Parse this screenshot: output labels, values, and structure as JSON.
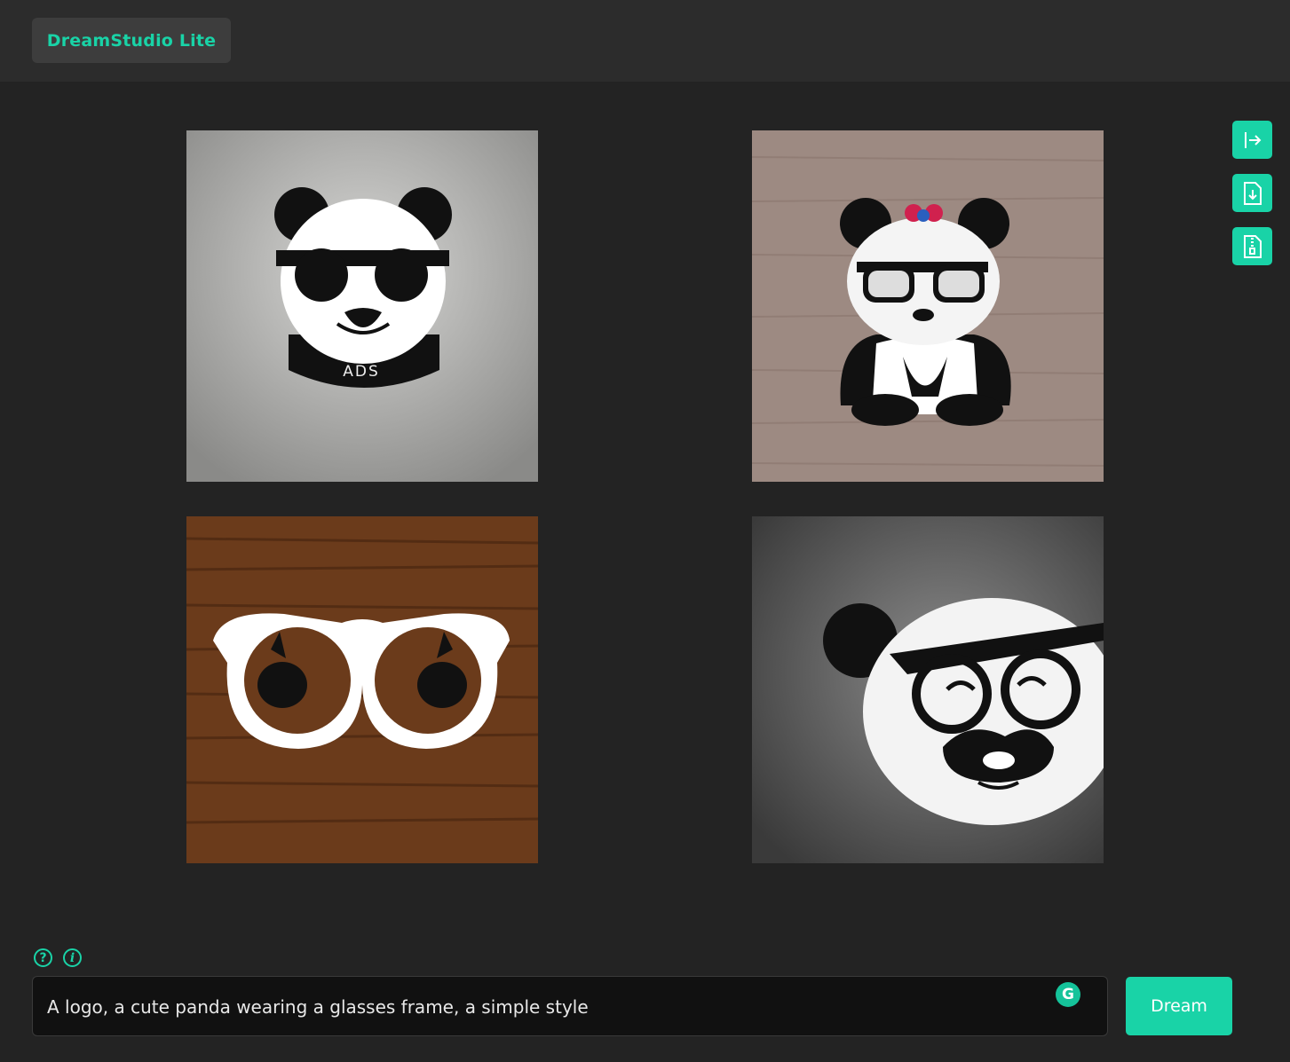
{
  "app": {
    "brand": "DreamStudio Lite",
    "accent": "#19d3a7"
  },
  "gallery": {
    "images": [
      {
        "name": "panda-sunglasses-logo",
        "caption_text": "ADS"
      },
      {
        "name": "panda-bow-glasses-logo"
      },
      {
        "name": "white-glasses-frame-logo"
      },
      {
        "name": "panda-face-circle-logo"
      }
    ]
  },
  "sidebar": {
    "buttons": [
      {
        "icon": "collapse-right-icon"
      },
      {
        "icon": "file-download-icon"
      },
      {
        "icon": "file-zip-icon"
      }
    ]
  },
  "help": {
    "question": "?",
    "info": "i"
  },
  "prompt": {
    "value": "A logo, a cute panda wearing a glasses frame, a simple style",
    "grammarly": "G"
  },
  "actions": {
    "dream_label": "Dream"
  }
}
